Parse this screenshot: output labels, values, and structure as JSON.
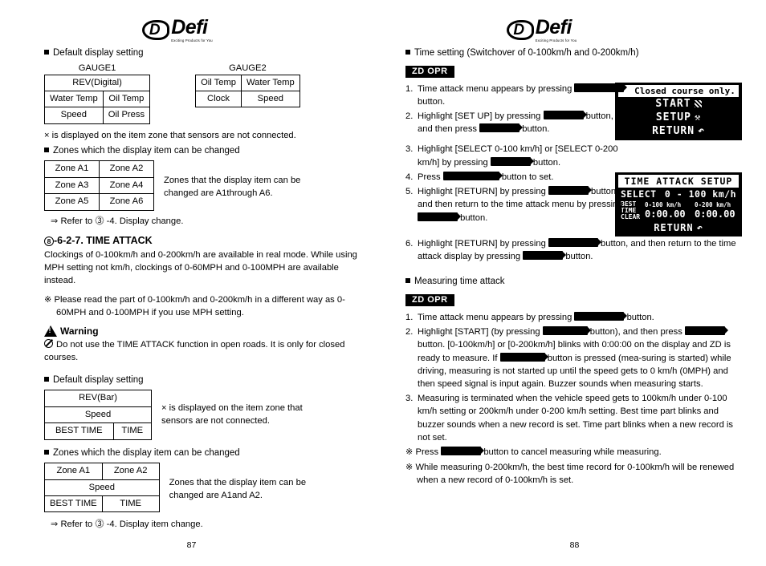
{
  "brand": {
    "letter": "D",
    "name": "Defi",
    "tagline": "Exciting Products for You"
  },
  "left": {
    "heading_default": "Default display setting",
    "gauge1": {
      "title": "GAUGE1",
      "rows": [
        [
          "REV(Digital)"
        ],
        [
          "Water Temp",
          "Oil Temp"
        ],
        [
          "Speed",
          "Oil Press"
        ]
      ]
    },
    "gauge2": {
      "title": "GAUGE2",
      "rows": [
        [
          "Oil Temp",
          "Water Temp"
        ],
        [
          "Clock",
          "Speed"
        ]
      ]
    },
    "x_note": "× is displayed on the item zone that sensors are not connected.",
    "heading_zones": "Zones which the display item can be changed",
    "zones1": [
      [
        "Zone A1",
        "Zone A2"
      ],
      [
        "Zone A3",
        "Zone A4"
      ],
      [
        "Zone A5",
        "Zone A6"
      ]
    ],
    "zones1_caption": "Zones that the display item can be changed are A1through A6.",
    "refer1": "⇒ Refer to ⓷ -4. Display change.",
    "section_title": "-6-2-7. TIME ATTACK",
    "section_num": "8",
    "section_body": "Clockings of 0-100km/h and 0-200km/h are available in real mode. While using MPH setting not km/h, clockings of 0-60MPH and 0-100MPH are available instead.",
    "note_mph": "※ Please read the part of 0-100km/h and 0-200km/h in a different way as 0-60MPH and 0-100MPH if you use MPH setting.",
    "warning_label": "Warning",
    "warning_text": "Do not use the TIME ATTACK function in open roads.  It is only for closed courses.",
    "heading_default2": "Default display setting",
    "gauge3": {
      "rows": [
        [
          "REV(Bar)"
        ],
        [
          "Speed"
        ],
        [
          "BEST TIME",
          "TIME"
        ]
      ]
    },
    "x_note2": "× is displayed on the item zone that sensors are not connected.",
    "heading_zones2": "Zones which the display item can be changed",
    "zones2": [
      [
        "Zone A1",
        "Zone A2"
      ],
      [
        "Speed"
      ],
      [
        "BEST TIME",
        "TIME"
      ]
    ],
    "zones2_caption": "Zones that the display item can be changed are A1and A2.",
    "refer2": "⇒ Refer to ⓷ -4. Display item change.",
    "folio": "87"
  },
  "right": {
    "heading_time": "Time setting (Switchover of 0-100km/h and 0-200km/h)",
    "zd_opr": "ZD OPR",
    "steps1": [
      {
        "num": "1.",
        "parts": [
          "Time attack menu appears by pressing",
          "BLK",
          "button."
        ]
      },
      {
        "num": "2.",
        "parts": [
          "Highlight [SET UP] by pressing",
          "BLK",
          "button, and then press",
          "BLK",
          "button."
        ]
      },
      {
        "num": "3.",
        "parts": [
          "Highlight [SELECT 0-100 km/h] or [SELECT 0-200 km/h] by pressing",
          "BLK",
          "button."
        ]
      },
      {
        "num": "4.",
        "parts": [
          "Press",
          "BLK",
          "button to set."
        ]
      },
      {
        "num": "5.",
        "parts": [
          "Highlight [RETURN] by pressing",
          "BLK",
          "button, and then return to the time attack menu by pressing",
          "BLK",
          "button."
        ]
      },
      {
        "num": "6.",
        "parts": [
          "Highlight [RETURN] by pressing",
          "BLK",
          "button, and then return to the time attack display by pressing",
          "BLK",
          "button."
        ]
      }
    ],
    "lcd1": {
      "header": "Closed course only.",
      "line1": "START",
      "line2": "SETUP",
      "line3": "RETURN"
    },
    "lcd2": {
      "title": "TIME ATTACK SETUP",
      "select_label": "SELECT",
      "select_value": "0 - 100 km/h",
      "best_label": "BEST",
      "time_label": "TIME",
      "clear_label": "CLEAR",
      "col1": "0-100 km/h",
      "col2": "0-200 km/h",
      "t1": "0:00.00",
      "t2": "0:00.00",
      "return": "RETURN"
    },
    "heading_measuring": "Measuring time attack",
    "zd_opr2": "ZD OPR",
    "steps2": [
      {
        "num": "1.",
        "parts": [
          "Time attack menu appears by pressing",
          "BLK",
          "button."
        ]
      },
      {
        "num": "2.",
        "parts": [
          "Highlight [START] (by pressing",
          "BLK",
          "button), and then press",
          "BLK",
          "button.  [0-100km/h] or [0-200km/h] blinks with 0:00:00 on the display and ZD is ready to measure.  If",
          "BLK",
          "button is pressed (mea-suring is started) while driving, measuring is not started up until the speed gets to 0 km/h (0MPH) and then speed signal is input again.  Buzzer sounds when measuring starts."
        ]
      },
      {
        "num": "3.",
        "parts": [
          "Measuring is terminated when the vehicle speed gets to 100km/h under 0-100 km/h setting or 200km/h under 0-200 km/h setting.  Best time part blinks and buzzer sounds when a new record is set.  Time part blinks when a new record is not set."
        ]
      }
    ],
    "note1_pre": "※ Press",
    "note1_post": "button to cancel measuring while measuring.",
    "note2": "※ While measuring 0-200km/h, the best time record for 0-100km/h will be renewed when a new record of 0-100km/h is set.",
    "folio": "88"
  }
}
